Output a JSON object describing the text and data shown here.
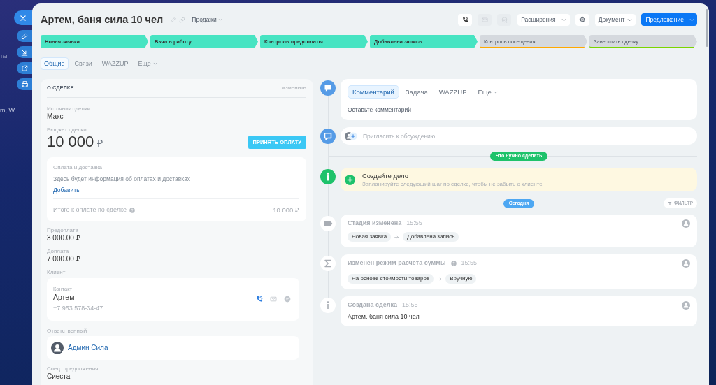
{
  "background_page": {
    "texts": [
      "ты",
      "m, W..."
    ]
  },
  "side_buttons": [
    {
      "kind": "close"
    },
    {
      "kind": "link"
    },
    {
      "kind": "arrow"
    },
    {
      "kind": "external"
    },
    {
      "kind": "print"
    }
  ],
  "header": {
    "title": "Артем, баня сила 10 чел",
    "category": "Продажи",
    "contact_actions": [
      {
        "kind": "phone",
        "disabled": false
      },
      {
        "kind": "mail",
        "disabled": true
      },
      {
        "kind": "chat",
        "disabled": true
      }
    ],
    "buttons": [
      {
        "kind": "split",
        "label": "Расширения"
      },
      {
        "kind": "settings"
      },
      {
        "kind": "dropdown",
        "label": "Документ"
      },
      {
        "kind": "primary",
        "label": "Предложение"
      }
    ]
  },
  "stages": [
    {
      "label": "Новая заявка",
      "passed": true,
      "color": "#47e4c2"
    },
    {
      "label": "Взял в работу",
      "passed": true,
      "color": "#47e4c2"
    },
    {
      "label": "Контроль предоплаты",
      "passed": true,
      "color": "#47e4c2"
    },
    {
      "label": "Добавлена запись",
      "passed": true,
      "color": "#47e4c2"
    },
    {
      "label": "Контроль посещения",
      "passed": false,
      "color": "#ffa900"
    },
    {
      "label": "Завершить сделку",
      "passed": false,
      "color": "#7bd500"
    }
  ],
  "tabs": [
    {
      "label": "Общие",
      "selected": true,
      "has_menu": false
    },
    {
      "label": "Связи",
      "selected": false,
      "has_menu": false
    },
    {
      "label": "WAZZUP",
      "selected": false,
      "has_menu": false
    },
    {
      "label": "Еще",
      "selected": false,
      "has_menu": true
    }
  ],
  "deal": {
    "title": "О СДЕЛКЕ",
    "edit_link": "изменить",
    "fields": [
      {
        "kind": "text",
        "label": "Источник сделки",
        "value": "Макс"
      },
      {
        "kind": "budget",
        "label": "Бюджет сделки",
        "amount": "10 000",
        "currency": "₽",
        "button": "ПРИНЯТЬ ОПЛАТУ"
      },
      {
        "kind": "payment",
        "title": "Оплата и доставка",
        "note": "Здесь будет информация об оплатах и доставках",
        "add_link": "Добавить",
        "total_label": "Итого к оплате по сделке",
        "total": "10 000 ₽"
      },
      {
        "kind": "text",
        "label": "Предоплата",
        "value": "3 000.00 ₽"
      },
      {
        "kind": "text",
        "label": "Доплата",
        "value": "7 000.00 ₽"
      },
      {
        "kind": "client",
        "label": "Клиент",
        "contact_label": "Контакт",
        "name": "Артем",
        "phone": "+7 953 578-34-47",
        "channels": [
          {
            "kind": "phone",
            "active": true
          },
          {
            "kind": "mail",
            "active": false
          },
          {
            "kind": "chat",
            "active": false
          }
        ]
      },
      {
        "kind": "responsible",
        "label": "Ответственный",
        "name": "Админ Сила"
      },
      {
        "kind": "text",
        "label": "Спец. предложения",
        "value": "Сиеста"
      }
    ]
  },
  "composer": {
    "tabs": [
      {
        "label": "Комментарий",
        "selected": true,
        "has_menu": false
      },
      {
        "label": "Задача",
        "selected": false,
        "has_menu": false
      },
      {
        "label": "WAZZUP",
        "selected": false,
        "has_menu": false
      },
      {
        "label": "Еще",
        "selected": false,
        "has_menu": true
      }
    ],
    "placeholder": "Оставьте комментарий"
  },
  "invite": {
    "placeholder": "Пригласить к обсуждению"
  },
  "todo": {
    "divider": "Что нужно сделать",
    "title": "Создайте дело",
    "hint": "Запланируйте следующий шаг по сделке, чтобы не забыть о клиенте"
  },
  "history": {
    "divider": "Сегодня",
    "filter": "ФИЛЬТР",
    "items": [
      {
        "kind": "stage_change",
        "title": "Стадия изменена",
        "time": "15:55",
        "help": false,
        "from": "Новая заявка",
        "to": "Добавлена запись"
      },
      {
        "kind": "sum_mode",
        "title": "Изменён режим расчёта суммы",
        "time": "15:55",
        "help": true,
        "from": "На основе стоимости товаров",
        "to": "Вручную"
      },
      {
        "kind": "created",
        "title": "Создана сделка",
        "time": "15:55",
        "help": false,
        "text": "Артем. баня сила 10 чел"
      }
    ]
  }
}
